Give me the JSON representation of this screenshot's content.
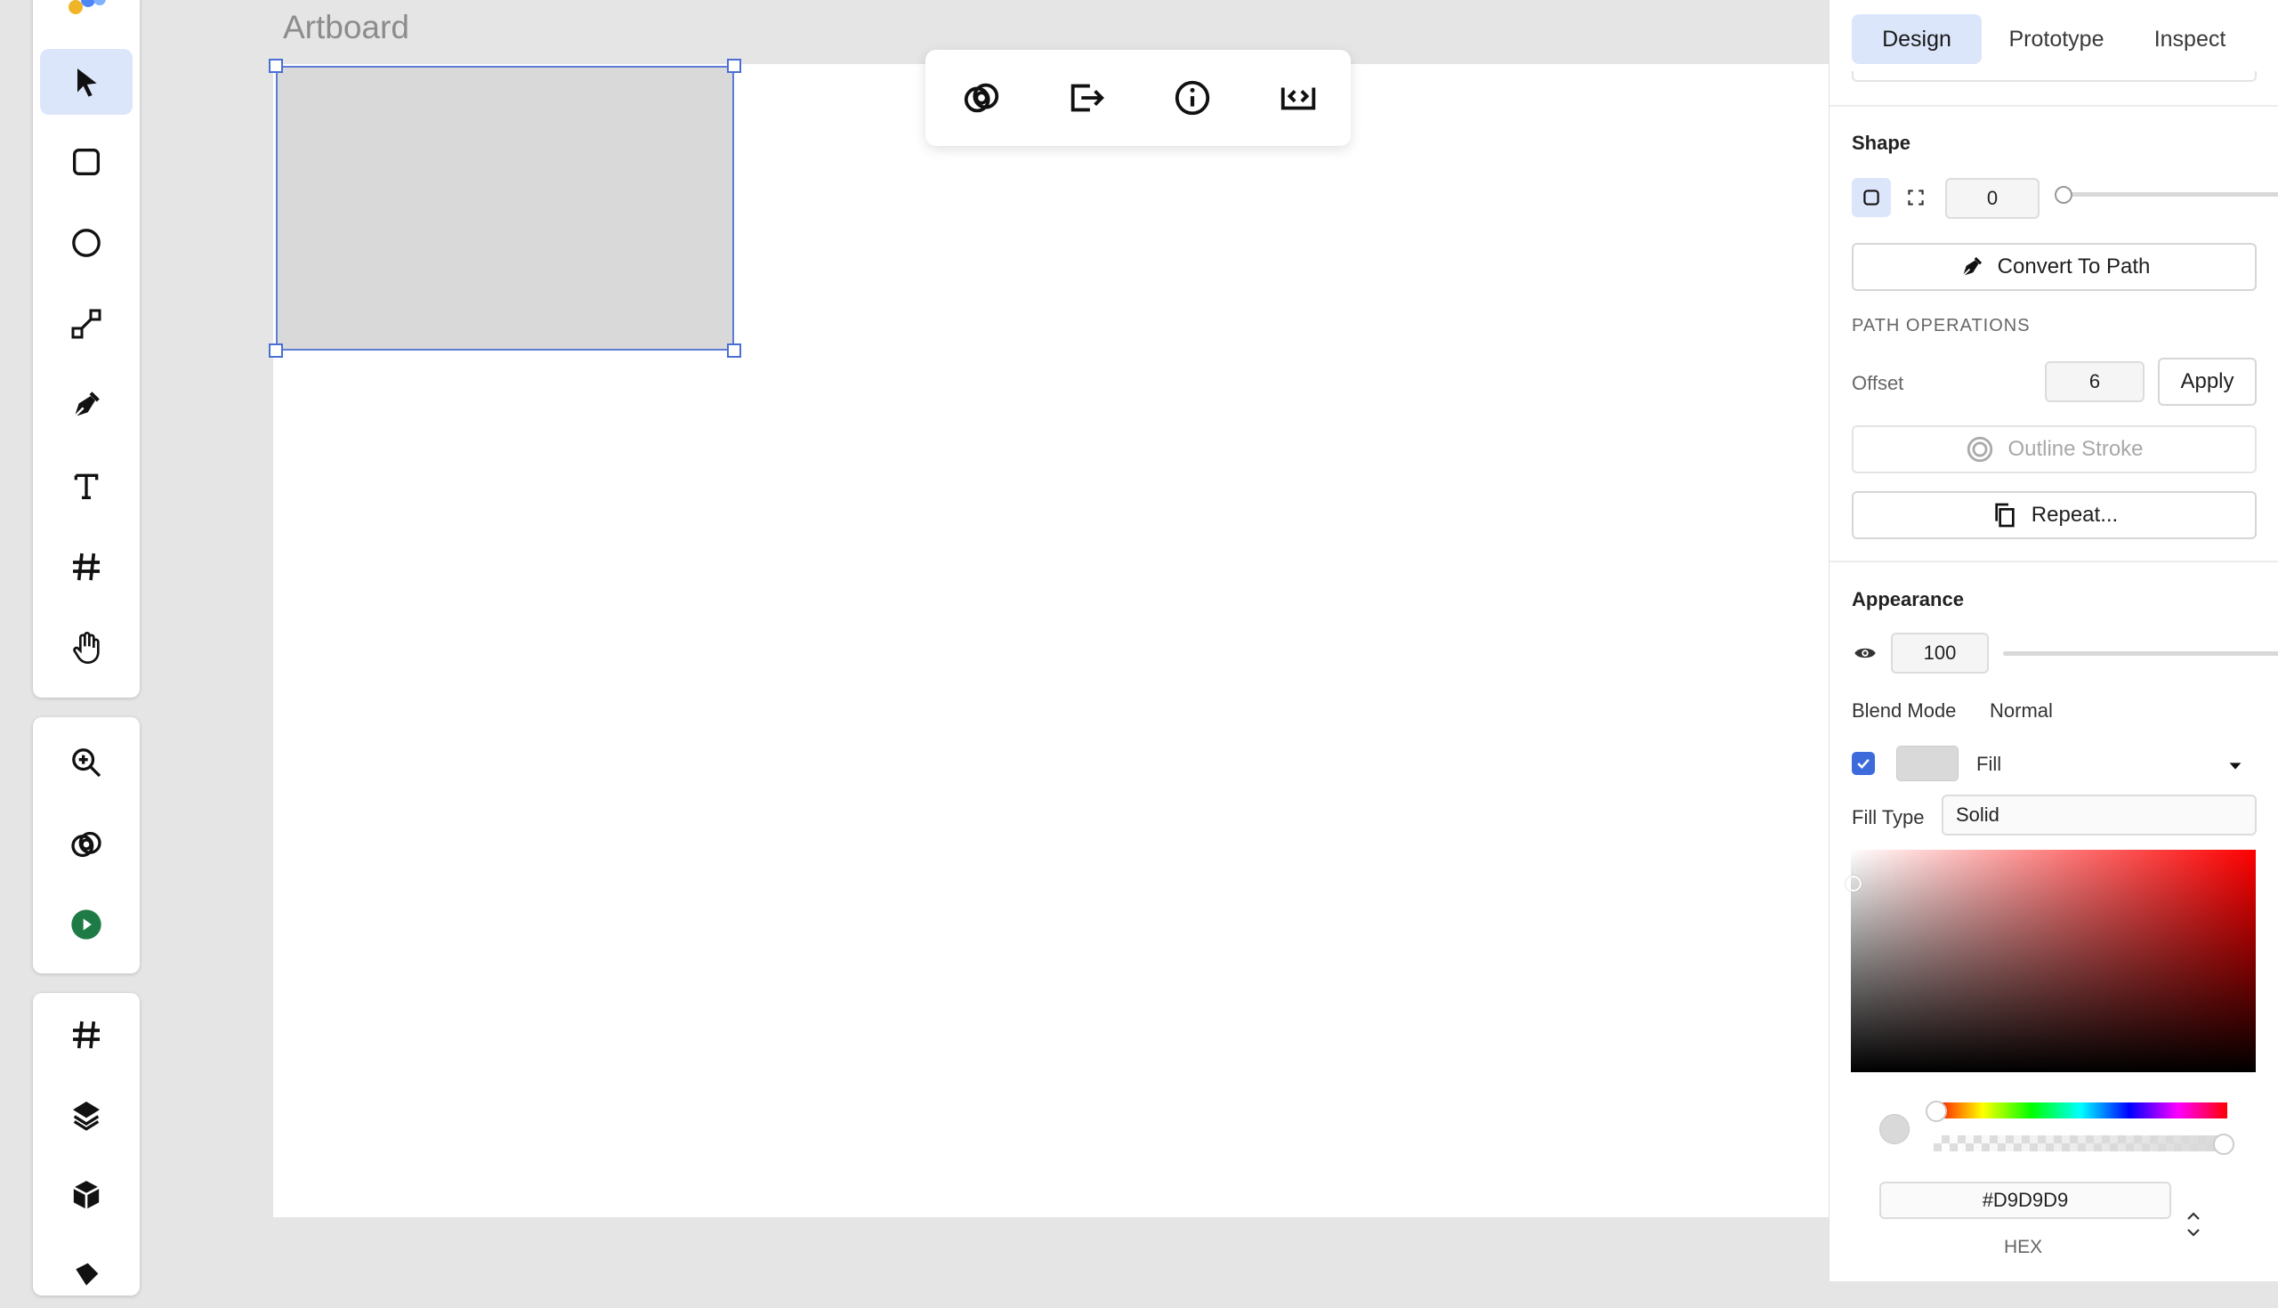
{
  "canvas": {
    "artboard_label": "Artboard"
  },
  "left_toolbar": {
    "tools": [
      "select-tool",
      "rectangle-tool",
      "ellipse-tool",
      "line-tool",
      "pen-tool",
      "text-tool",
      "frame-tool",
      "hand-tool"
    ],
    "secondary": [
      "zoom-tool",
      "boolean-tool",
      "play-button"
    ],
    "tertiary": [
      "frames-panel",
      "layers-panel",
      "assets-panel"
    ]
  },
  "floating_toolbar": {
    "buttons": [
      "boolean-operations-icon",
      "export-icon",
      "info-icon",
      "code-icon"
    ]
  },
  "panel": {
    "tabs": {
      "design": "Design",
      "prototype": "Prototype",
      "inspect": "Inspect"
    },
    "shape": {
      "title": "Shape",
      "corner_radius": "0",
      "convert_to_path": "Convert To Path",
      "path_operations_title": "PATH OPERATIONS",
      "offset_label": "Offset",
      "offset_value": "6",
      "apply": "Apply",
      "outline_stroke": "Outline Stroke",
      "repeat": "Repeat..."
    },
    "appearance": {
      "title": "Appearance",
      "opacity": "100",
      "blend_mode_label": "Blend Mode",
      "blend_mode_value": "Normal",
      "fill_label": "Fill",
      "fill_type_label": "Fill Type",
      "fill_type_value": "Solid",
      "hex_value": "#D9D9D9",
      "hex_label": "HEX"
    }
  },
  "colors": {
    "accent": "#3d6bdc",
    "active_bg": "#dce6fb",
    "fill": "#d9d9d9",
    "play_green": "#1e7b45"
  }
}
